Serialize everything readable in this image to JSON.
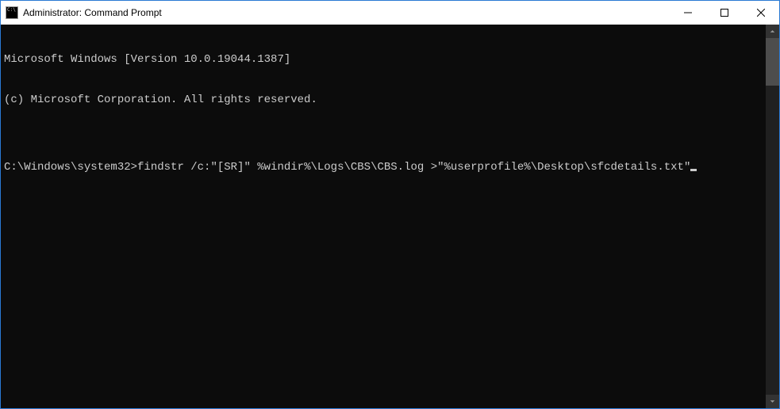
{
  "window": {
    "title": "Administrator: Command Prompt"
  },
  "terminal": {
    "line1": "Microsoft Windows [Version 10.0.19044.1387]",
    "line2": "(c) Microsoft Corporation. All rights reserved.",
    "blank": "",
    "prompt": "C:\\Windows\\system32>",
    "command": "findstr /c:\"[SR]\" %windir%\\Logs\\CBS\\CBS.log >\"%userprofile%\\Desktop\\sfcdetails.txt\""
  }
}
